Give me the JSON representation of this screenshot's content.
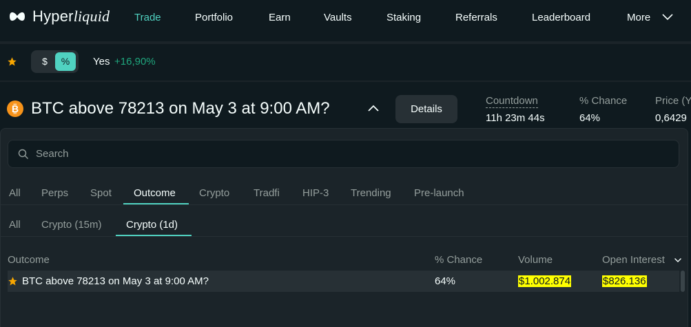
{
  "brand": {
    "name_regular": "Hyper",
    "name_italic": "liquid"
  },
  "nav": {
    "trade": "Trade",
    "portfolio": "Portfolio",
    "earn": "Earn",
    "vaults": "Vaults",
    "staking": "Staking",
    "referrals": "Referrals",
    "leaderboard": "Leaderboard",
    "more": "More"
  },
  "favorites": {
    "unit_dollar": "$",
    "unit_percent": "%",
    "selected_unit": "%",
    "item_name": "Yes",
    "item_change": "+16,90%"
  },
  "market": {
    "title": "BTC above 78213 on May 3 at 9:00 AM?",
    "details_label": "Details",
    "stats": {
      "countdown_label": "Countdown",
      "countdown_value": "11h 23m 44s",
      "chance_label": "% Chance",
      "chance_value": "64%",
      "price_label": "Price (Y",
      "price_value": "0,6429"
    }
  },
  "selector": {
    "search_placeholder": "Search",
    "tabs": [
      "All",
      "Perps",
      "Spot",
      "Outcome",
      "Crypto",
      "Tradfi",
      "HIP-3",
      "Trending",
      "Pre-launch"
    ],
    "active_tab": "Outcome",
    "subtabs": [
      "All",
      "Crypto (15m)",
      "Crypto (1d)"
    ],
    "active_subtab": "Crypto (1d)",
    "columns": {
      "outcome": "Outcome",
      "chance": "% Chance",
      "volume": "Volume",
      "open_interest": "Open Interest"
    },
    "rows": [
      {
        "outcome": "BTC above 78213 on May 3 at 9:00 AM?",
        "chance": "64%",
        "volume": "$1.002.874",
        "open_interest": "$826.136"
      }
    ]
  },
  "colors": {
    "background": "#0f1a1f",
    "panel": "#1b2429",
    "accent": "#50d2c1",
    "positive": "#1fa67d",
    "muted_text": "#949e9c",
    "favorite_star": "#f7a600",
    "btc_orange": "#f7931a",
    "highlight": "#ffff00"
  },
  "icons": {
    "logo": "hyperliquid-logo-icon",
    "more": "chevron-down-icon",
    "favorite": "star-icon",
    "coin": "bitcoin-icon",
    "collapse": "chevron-up-icon",
    "search": "search-icon",
    "sort": "chevron-down-icon"
  }
}
